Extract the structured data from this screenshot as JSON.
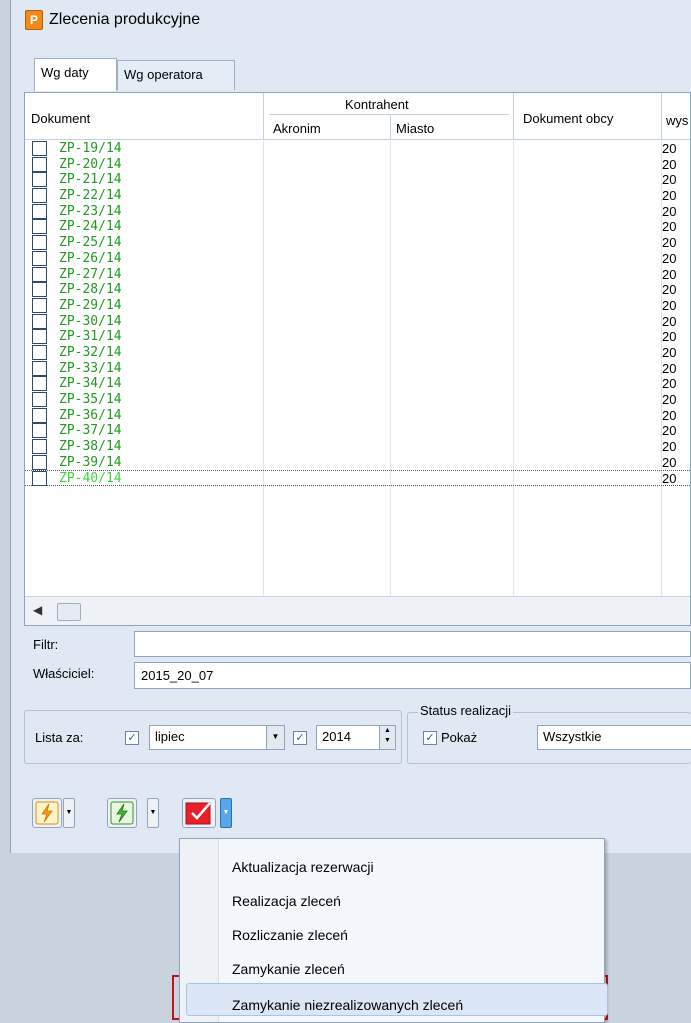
{
  "window": {
    "title": "Zlecenia produkcyjne",
    "icon_letter": "P"
  },
  "tabs": [
    {
      "label": "Wg daty"
    },
    {
      "label": "Wg operatora"
    }
  ],
  "grid": {
    "headers": {
      "dokument": "Dokument",
      "kontrahent": "Kontrahent",
      "akronim": "Akronim",
      "miasto": "Miasto",
      "dokument_obcy": "Dokument obcy",
      "wys": "wys"
    },
    "rows": [
      {
        "doc": "ZP-19/14",
        "dt": "20"
      },
      {
        "doc": "ZP-20/14",
        "dt": "20"
      },
      {
        "doc": "ZP-21/14",
        "dt": "20"
      },
      {
        "doc": "ZP-22/14",
        "dt": "20"
      },
      {
        "doc": "ZP-23/14",
        "dt": "20"
      },
      {
        "doc": "ZP-24/14",
        "dt": "20"
      },
      {
        "doc": "ZP-25/14",
        "dt": "20"
      },
      {
        "doc": "ZP-26/14",
        "dt": "20"
      },
      {
        "doc": "ZP-27/14",
        "dt": "20"
      },
      {
        "doc": "ZP-28/14",
        "dt": "20"
      },
      {
        "doc": "ZP-29/14",
        "dt": "20"
      },
      {
        "doc": "ZP-30/14",
        "dt": "20"
      },
      {
        "doc": "ZP-31/14",
        "dt": "20"
      },
      {
        "doc": "ZP-32/14",
        "dt": "20"
      },
      {
        "doc": "ZP-33/14",
        "dt": "20"
      },
      {
        "doc": "ZP-34/14",
        "dt": "20"
      },
      {
        "doc": "ZP-35/14",
        "dt": "20"
      },
      {
        "doc": "ZP-36/14",
        "dt": "20"
      },
      {
        "doc": "ZP-37/14",
        "dt": "20"
      },
      {
        "doc": "ZP-38/14",
        "dt": "20"
      },
      {
        "doc": "ZP-39/14",
        "dt": "20"
      },
      {
        "doc": "ZP-40/14",
        "dt": "20",
        "selected": true
      }
    ]
  },
  "filter": {
    "label": "Filtr:",
    "value": ""
  },
  "owner": {
    "label": "Właściciel:",
    "value": "2015_20_07"
  },
  "list_for": {
    "label": "Lista za:",
    "month": "lipiec",
    "year": "2014",
    "month_checked": true,
    "year_checked": true
  },
  "status": {
    "legend": "Status realizacji",
    "show_label": "Pokaż",
    "show_checked": true,
    "value": "Wszystkie"
  },
  "context_menu": {
    "items": [
      "Aktualizacja rezerwacji",
      "Realizacja zleceń",
      "Rozliczanie zleceń",
      "Zamykanie zleceń",
      "Zamykanie niezrealizowanych zleceń"
    ],
    "highlighted_index": 4
  },
  "colors": {
    "doc_text": "#1f9b1f",
    "selected_doc_text": "#3ad63a",
    "highlight_border": "#c0121b"
  }
}
